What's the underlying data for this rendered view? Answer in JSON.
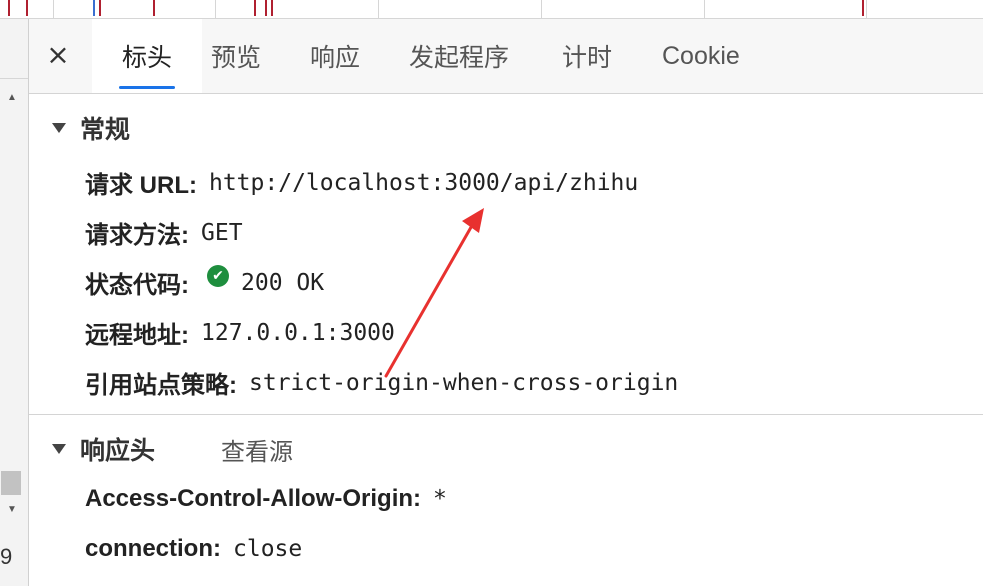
{
  "tabs": {
    "close_label": "×",
    "items": [
      {
        "label": "标头",
        "active": true
      },
      {
        "label": "预览",
        "active": false
      },
      {
        "label": "响应",
        "active": false
      },
      {
        "label": "发起程序",
        "active": false
      },
      {
        "label": "计时",
        "active": false
      },
      {
        "label": "Cookie",
        "active": false
      }
    ]
  },
  "general": {
    "title": "常规",
    "rows": {
      "request_url": {
        "key": "请求 URL:",
        "value": "http://localhost:3000/api/zhihu"
      },
      "request_method": {
        "key": "请求方法:",
        "value": "GET"
      },
      "status_code": {
        "key": "状态代码:",
        "value": "200 OK"
      },
      "remote_address": {
        "key": "远程地址:",
        "value": "127.0.0.1:3000"
      },
      "referrer_policy": {
        "key": "引用站点策略:",
        "value": "strict-origin-when-cross-origin"
      }
    }
  },
  "response_headers": {
    "title": "响应头",
    "view_source": "查看源",
    "rows": {
      "acao": {
        "key": "Access-Control-Allow-Origin:",
        "value": "*"
      },
      "connection": {
        "key": "connection:",
        "value": "close"
      }
    }
  },
  "left_panel": {
    "row_number": "9"
  },
  "colors": {
    "accent": "#1a73e8",
    "status_ok": "#1e8e3e",
    "annotation_arrow": "#e8312f",
    "timeline_tick": "#b02030"
  },
  "icons": {
    "status": "check-circle-icon",
    "collapse": "triangle-down-icon",
    "close": "close-icon"
  }
}
